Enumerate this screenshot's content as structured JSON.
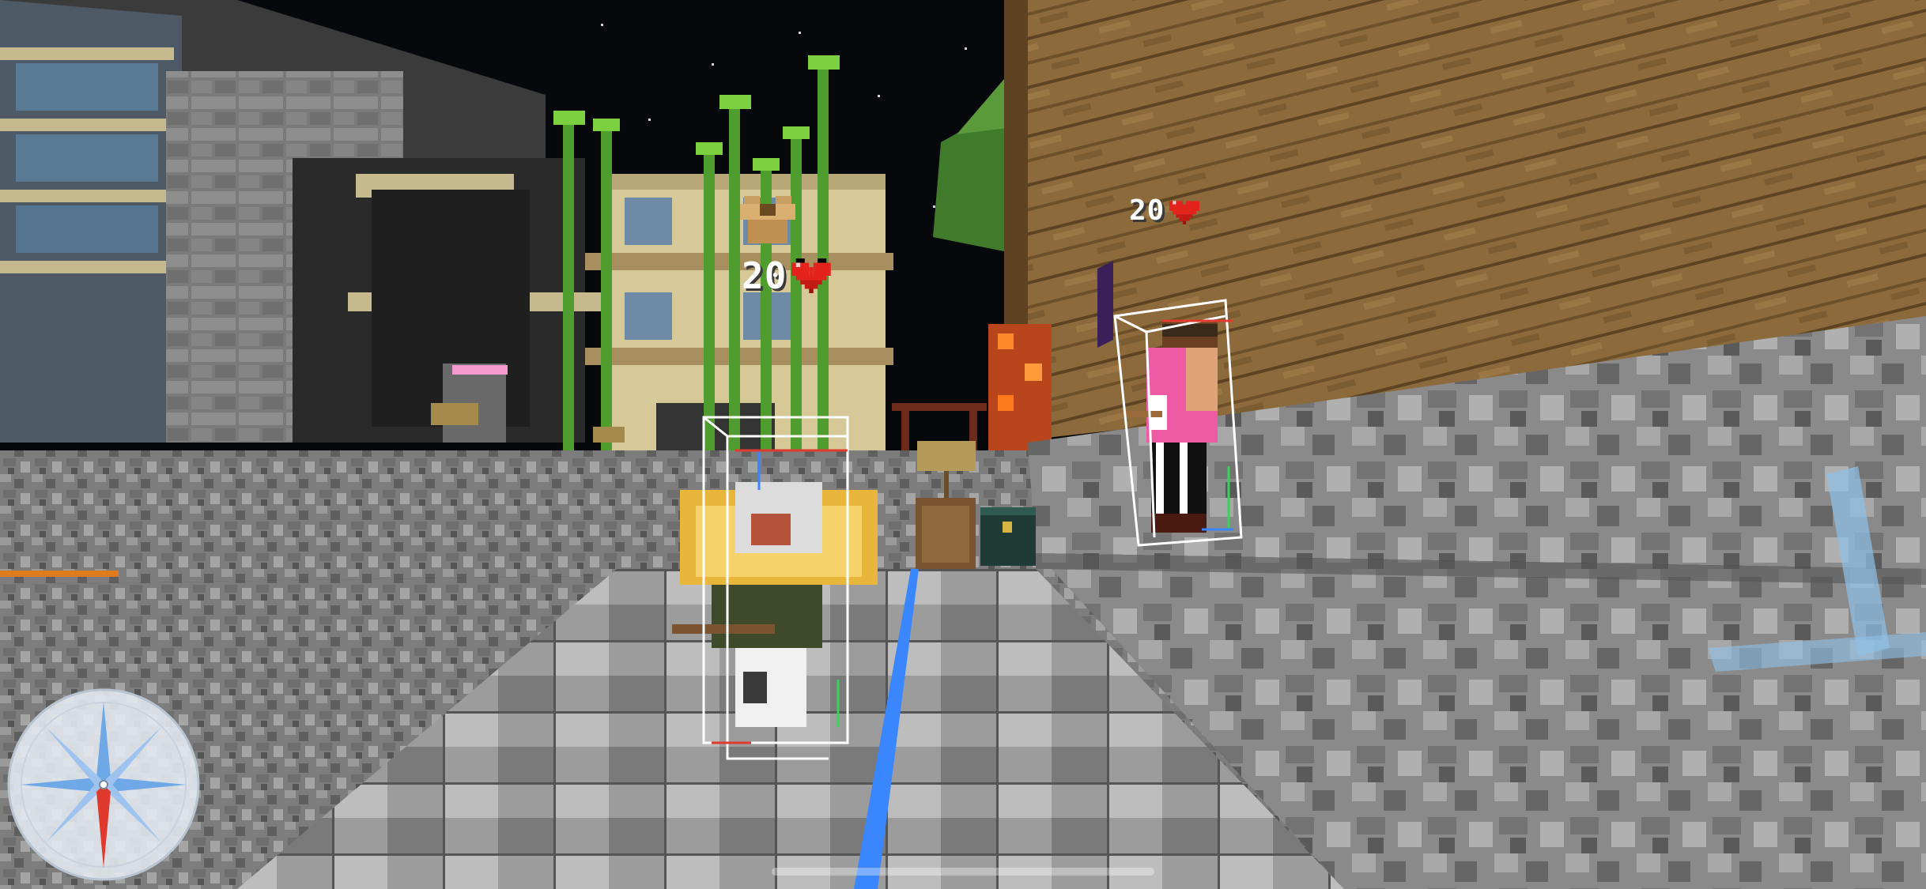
{
  "hud": {
    "nametag_a": {
      "health": "20",
      "icon": "heart-icon",
      "armor_icon": "chestplate-icon"
    },
    "nametag_b": {
      "health": "20",
      "icon": "heart-icon"
    },
    "compass": {
      "icon": "compass-icon",
      "needle_color": "#e03a2f",
      "star_color": "#6fa8e6"
    }
  },
  "colors": {
    "sky": "#07080b",
    "stone": "#8b8b8b",
    "wood": "#8a6a3b",
    "hitbox": "#ffffff",
    "look_line": "#3a86ff",
    "heart": "#e3231c"
  }
}
